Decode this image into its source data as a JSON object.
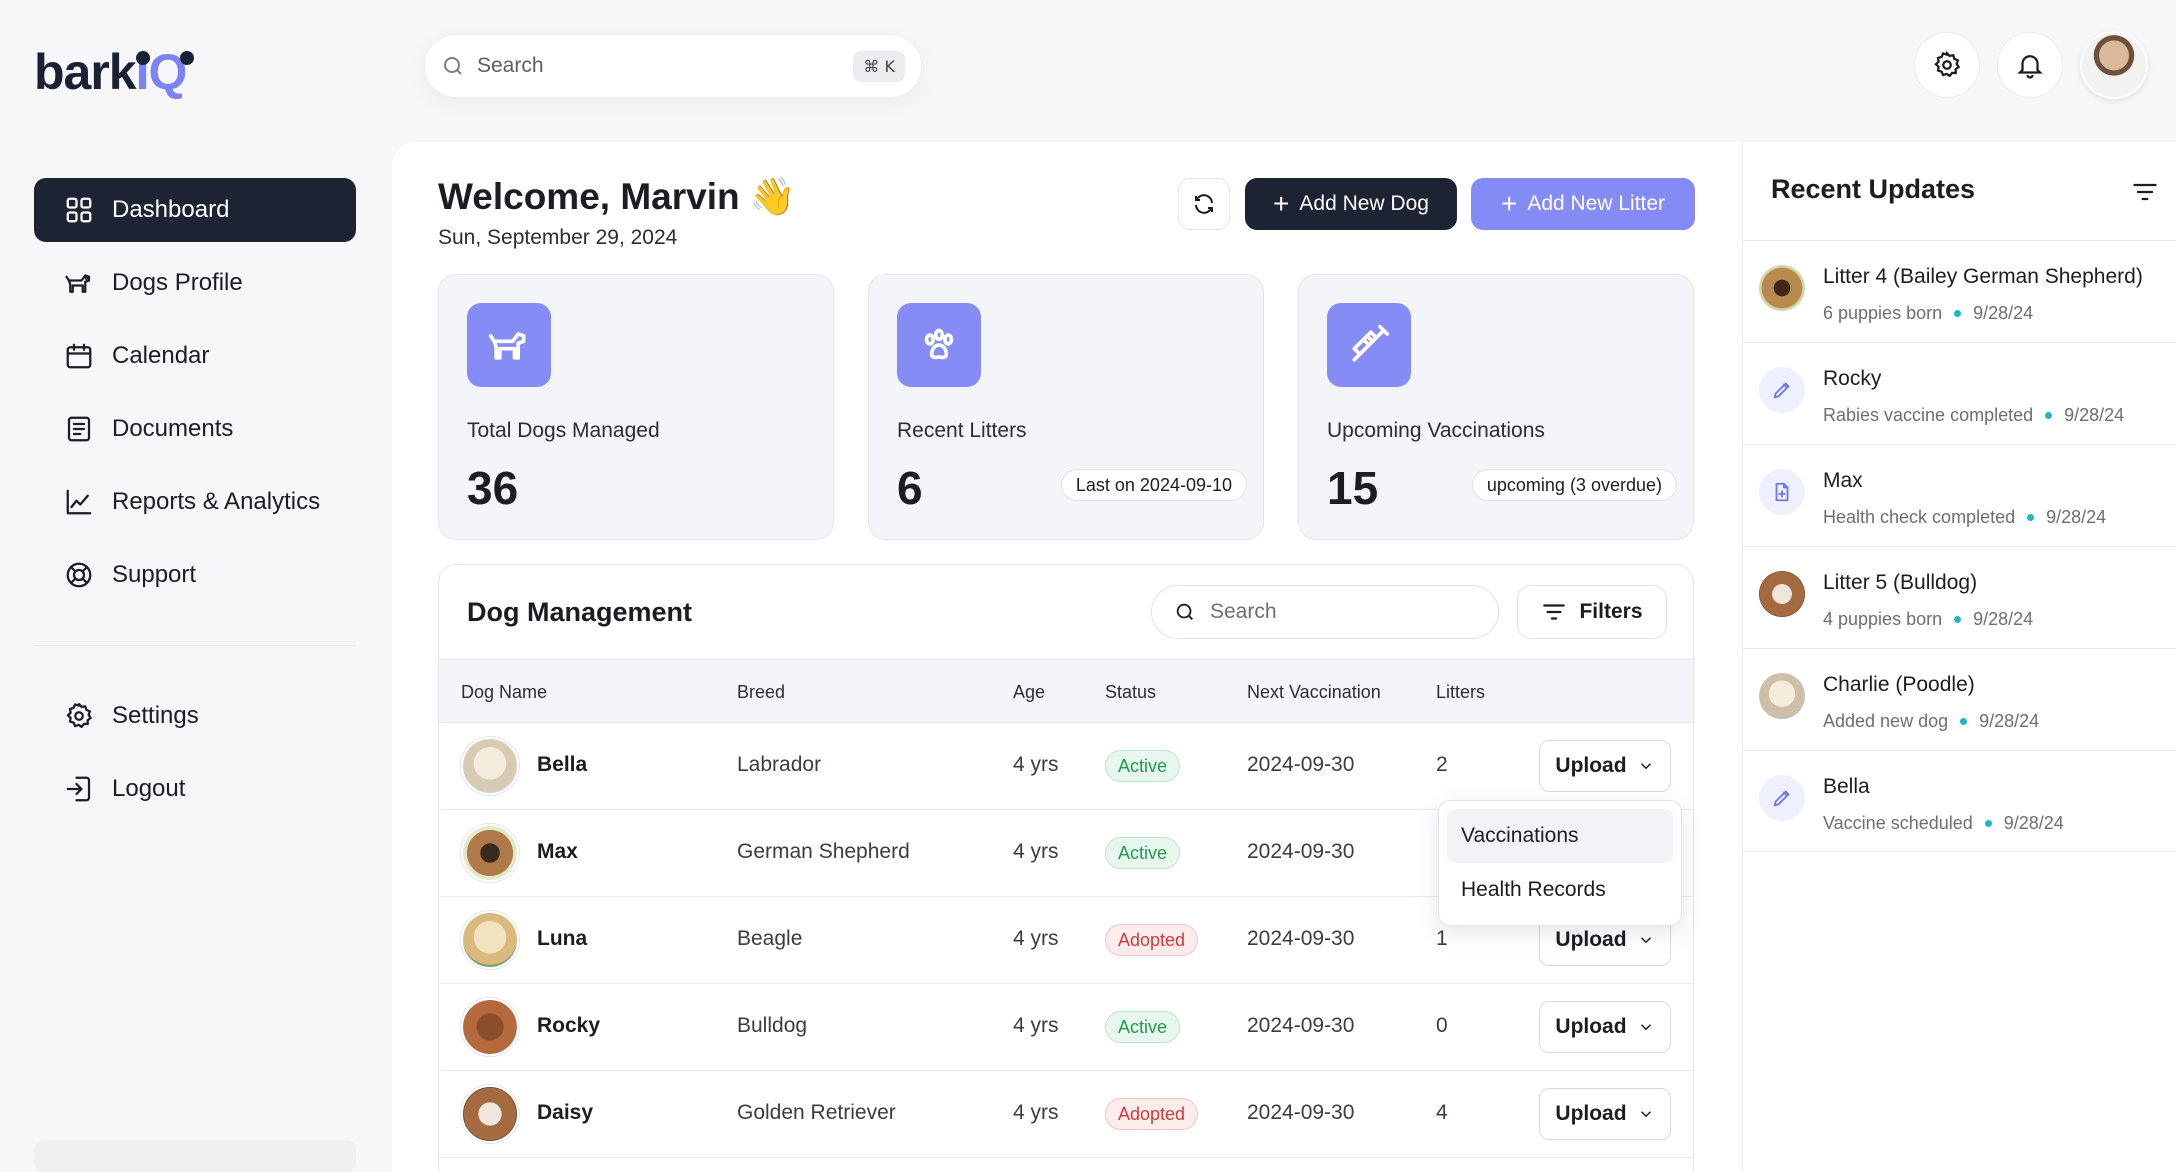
{
  "app": {
    "logo_main": "bark",
    "logo_accent": "IQ"
  },
  "sidebar": {
    "items": [
      {
        "label": "Dashboard",
        "icon": "grid-icon",
        "active": true
      },
      {
        "label": "Dogs Profile",
        "icon": "dog-icon"
      },
      {
        "label": "Calendar",
        "icon": "calendar-icon"
      },
      {
        "label": "Documents",
        "icon": "document-icon"
      },
      {
        "label": "Reports & Analytics",
        "icon": "chart-line-icon"
      }
    ],
    "support": {
      "label": "Support",
      "icon": "lifebuoy-icon"
    },
    "settings": {
      "label": "Settings",
      "icon": "gear-icon"
    },
    "logout": {
      "label": "Logout",
      "icon": "logout-icon"
    }
  },
  "topbar": {
    "search_placeholder": "Search",
    "shortcut": "⌘ K"
  },
  "header": {
    "welcome": "Welcome, Marvin 👋",
    "date": "Sun, September 29, 2024",
    "add_dog_label": "Add New Dog",
    "add_litter_label": "Add New Litter"
  },
  "stats": [
    {
      "label": "Total Dogs Managed",
      "value": "36",
      "chip": "",
      "icon": "dog-icon"
    },
    {
      "label": "Recent Litters",
      "value": "6",
      "chip": "Last on 2024-09-10",
      "icon": "paw-icon"
    },
    {
      "label": "Upcoming Vaccinations",
      "value": "15",
      "chip": "upcoming (3 overdue)",
      "icon": "syringe-icon"
    }
  ],
  "table": {
    "title": "Dog Management",
    "search_placeholder": "Search",
    "filters_label": "Filters",
    "columns": [
      "Dog Name",
      "Breed",
      "Age",
      "Status",
      "Next Vaccination",
      "Litters"
    ],
    "upload_label": "Upload",
    "rows": [
      {
        "name": "Bella",
        "breed": "Labrador",
        "age": "4 yrs",
        "status": "Active",
        "next_vaccination": "2024-09-30",
        "litters": "2"
      },
      {
        "name": "Max",
        "breed": "German Shepherd",
        "age": "4 yrs",
        "status": "Active",
        "next_vaccination": "2024-09-30",
        "litters": ""
      },
      {
        "name": "Luna",
        "breed": "Beagle",
        "age": "4 yrs",
        "status": "Adopted",
        "next_vaccination": "2024-09-30",
        "litters": "1"
      },
      {
        "name": "Rocky",
        "breed": "Bulldog",
        "age": "4 yrs",
        "status": "Active",
        "next_vaccination": "2024-09-30",
        "litters": "0"
      },
      {
        "name": "Daisy",
        "breed": "Golden Retriever",
        "age": "4 yrs",
        "status": "Adopted",
        "next_vaccination": "2024-09-30",
        "litters": "4"
      }
    ],
    "dropdown": [
      "Vaccinations",
      "Health Records"
    ]
  },
  "updates": {
    "title": "Recent Updates",
    "items": [
      {
        "title": "Litter 4 (Bailey German Shepherd)",
        "sub": "6 puppies born",
        "date": "9/28/24",
        "kind": "avatar"
      },
      {
        "title": "Rocky",
        "sub": "Rabies vaccine completed",
        "date": "9/28/24",
        "kind": "pencil-icon"
      },
      {
        "title": "Max",
        "sub": "Health check completed",
        "date": "9/28/24",
        "kind": "file-plus-icon"
      },
      {
        "title": "Litter 5 (Bulldog)",
        "sub": "4 puppies born",
        "date": "9/28/24",
        "kind": "avatar"
      },
      {
        "title": "Charlie (Poodle)",
        "sub": "Added new dog",
        "date": "9/28/24",
        "kind": "avatar"
      },
      {
        "title": "Bella",
        "sub": "Vaccine scheduled",
        "date": "9/28/24",
        "kind": "pencil-icon"
      }
    ]
  },
  "colors": {
    "accent": "#848bf5",
    "dark": "#1c2333",
    "active_green": "#1f9a4f",
    "adopted_red": "#d23b3b"
  }
}
